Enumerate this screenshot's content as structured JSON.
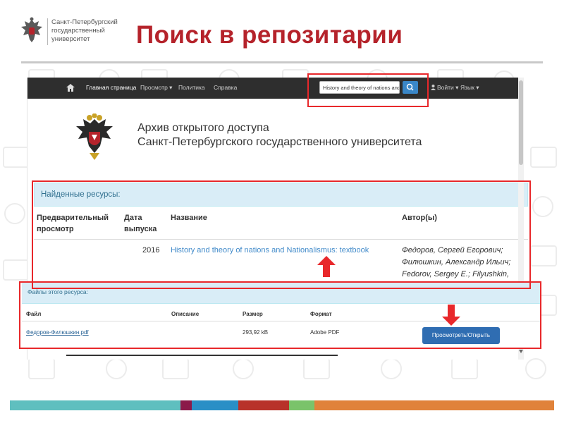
{
  "slide": {
    "title": "Поиск в репозитарии",
    "university_logo_text": [
      "Санкт-Петербургский",
      "государственный",
      "университет"
    ],
    "title_color": "#b5232b"
  },
  "navbar": {
    "home_icon": "home-icon",
    "items": [
      "Главная страница",
      "Просмотр ▾",
      "Политика",
      "Справка"
    ],
    "search_value": "History and theory of nations and",
    "search_button_icon": "search-icon",
    "login_label": "Войти ▾",
    "language_label": "Язык ▾"
  },
  "header": {
    "title_line1": "Архив открытого доступа",
    "title_line2": "Санкт-Петербургского государственного университета"
  },
  "found_resources": {
    "heading": "Найденные ресурсы:",
    "columns": {
      "preview": [
        "Предварительный",
        "просмотр"
      ],
      "date": [
        "Дата",
        "выпуска"
      ],
      "title": "Название",
      "authors": "Автор(ы)"
    },
    "rows": [
      {
        "preview": "",
        "date": "2016",
        "title": "History and theory of nations and Nationalismus: textbook",
        "authors": [
          "Федоров, Сергей Егорович;",
          "Филюшкин, Александр Ильич;",
          "Fedorov, Sergey E.; Filyushkin,"
        ]
      }
    ]
  },
  "files": {
    "heading": "Файлы этого ресурса:",
    "columns": [
      "Файл",
      "Описание",
      "Размер",
      "Формат"
    ],
    "rows": [
      {
        "file": "Федоров-Филюшкин.pdf",
        "description": "",
        "size": "293,92 kB",
        "format": "Adobe PDF",
        "action": "Просмотреть/Открыть"
      }
    ]
  },
  "colors": {
    "accent_red": "#e8282b",
    "link_blue": "#428bca",
    "panel_heading_bg": "#d9edf7",
    "navbar_bg": "#2e2e2e",
    "button_blue": "#2f6db2"
  },
  "footer_band_colors": [
    "#5fbfbf",
    "#8b1a4a",
    "#2a8fc6",
    "#b8322a",
    "#7ac36a",
    "#e0823a"
  ]
}
